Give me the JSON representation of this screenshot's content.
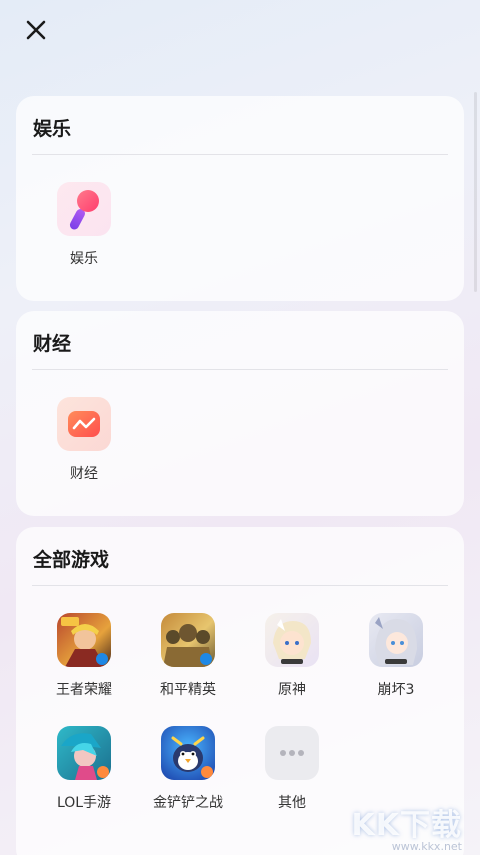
{
  "header": {
    "close_icon": "close-icon"
  },
  "sections": [
    {
      "title": "娱乐",
      "items": [
        {
          "label": "娱乐",
          "icon": "microphone-icon"
        }
      ]
    },
    {
      "title": "财经",
      "items": [
        {
          "label": "财经",
          "icon": "chart-line-icon"
        }
      ]
    },
    {
      "title": "全部游戏",
      "items": [
        {
          "label": "王者荣耀",
          "icon": "honor-of-kings-icon"
        },
        {
          "label": "和平精英",
          "icon": "peacekeeper-elite-icon"
        },
        {
          "label": "原神",
          "icon": "genshin-icon"
        },
        {
          "label": "崩坏3",
          "icon": "honkai-icon"
        },
        {
          "label": "LOL手游",
          "icon": "lol-mobile-icon"
        },
        {
          "label": "金铲铲之战",
          "icon": "golden-spatula-icon"
        },
        {
          "label": "其他",
          "icon": "more-icon"
        }
      ]
    }
  ],
  "watermark": {
    "logo": "KK下载",
    "url": "www.kkx.net"
  }
}
